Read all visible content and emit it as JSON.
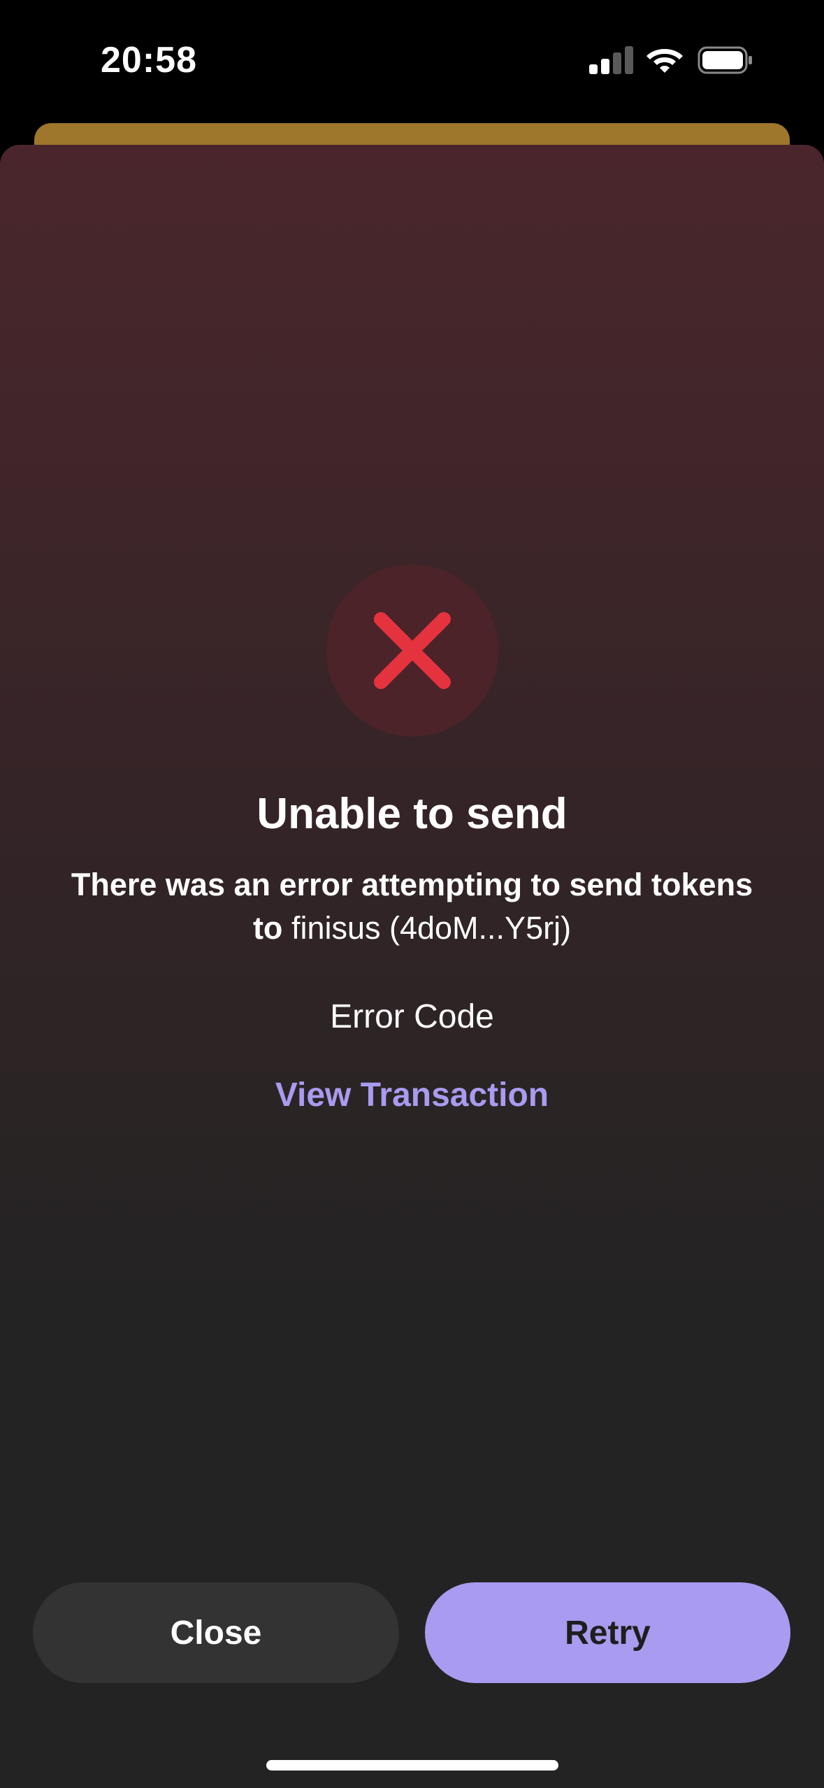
{
  "status_bar": {
    "time": "20:58"
  },
  "dialog": {
    "title": "Unable to send",
    "message_prefix": "There was an error attempting to send tokens to",
    "recipient": "finisus (4doM...Y5rj)",
    "error_code_label": "Error Code",
    "view_transaction_label": "View Transaction"
  },
  "buttons": {
    "close_label": "Close",
    "retry_label": "Retry"
  },
  "icons": {
    "error": "x-icon",
    "signal": "cellular-signal-icon",
    "wifi": "wifi-icon",
    "battery": "battery-icon"
  },
  "colors": {
    "background": "#000000",
    "back_sheet": "#9E762C",
    "sheet_top": "#4A262C",
    "sheet_bottom": "#232323",
    "error_circle": "#4C2328",
    "error_red": "#E5323F",
    "accent": "#A99BEF",
    "retry_text": "#1E1E1E",
    "close_bg": "#333333",
    "text": "#FFFFFF"
  }
}
